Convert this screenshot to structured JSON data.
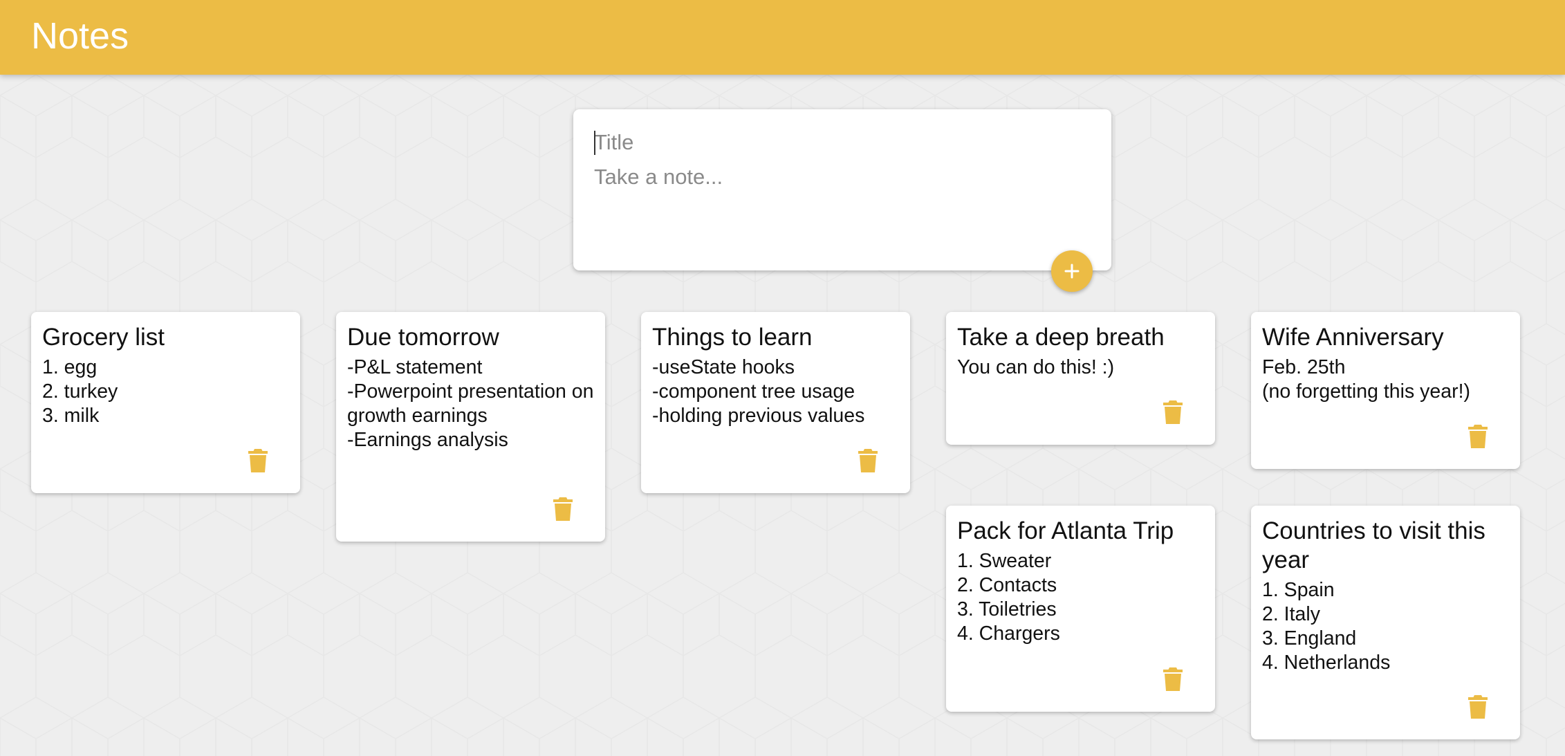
{
  "header": {
    "title": "Notes"
  },
  "create_area": {
    "title_placeholder": "Title",
    "content_placeholder": "Take a note...",
    "add_icon": "plus-icon"
  },
  "notes": [
    {
      "title": "Grocery list",
      "content": "1. egg\n2. turkey\n3. milk"
    },
    {
      "title": "Due tomorrow",
      "content": "-P&L statement\n-Powerpoint presentation on growth earnings\n-Earnings analysis"
    },
    {
      "title": "Things to learn",
      "content": "-useState hooks\n-component tree usage\n-holding previous values"
    },
    {
      "title": "Take a deep breath",
      "content": "You can do this! :)"
    },
    {
      "title": "Wife Anniversary",
      "content": "Feb. 25th\n(no forgetting this year!)"
    },
    {
      "title": "Pack for Atlanta Trip",
      "content": "1. Sweater\n2. Contacts\n3. Toiletries\n4. Chargers"
    },
    {
      "title": "Countries to visit this year",
      "content": "1. Spain\n2. Italy\n3. England\n4. Netherlands"
    }
  ],
  "colors": {
    "accent": "#ecbc45",
    "background": "#eeeeee",
    "card": "#ffffff"
  },
  "icons": {
    "delete": "trash-icon"
  }
}
